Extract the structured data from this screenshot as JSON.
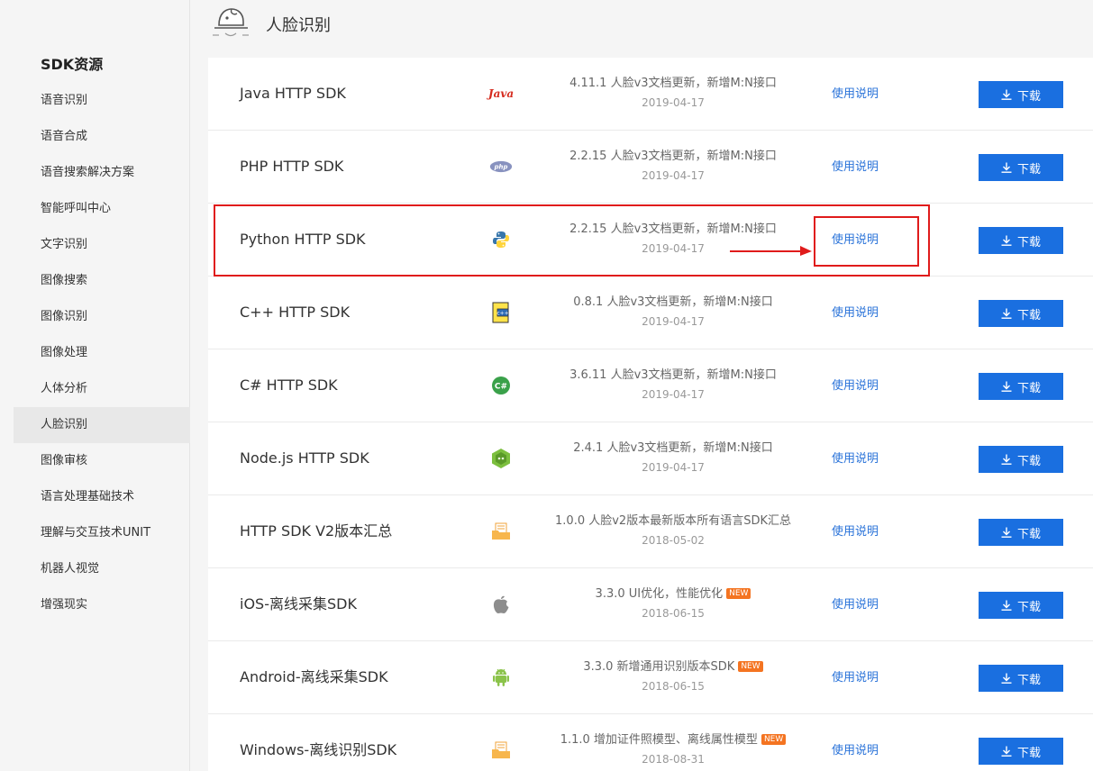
{
  "sidebar": {
    "title": "SDK资源",
    "items": [
      {
        "label": "语音识别"
      },
      {
        "label": "语音合成"
      },
      {
        "label": "语音搜索解决方案"
      },
      {
        "label": "智能呼叫中心"
      },
      {
        "label": "文字识别"
      },
      {
        "label": "图像搜索"
      },
      {
        "label": "图像识别"
      },
      {
        "label": "图像处理"
      },
      {
        "label": "人体分析"
      },
      {
        "label": "人脸识别",
        "active": true
      },
      {
        "label": "图像审核"
      },
      {
        "label": "语言处理基础技术"
      },
      {
        "label": "理解与交互技术UNIT"
      },
      {
        "label": "机器人视觉"
      },
      {
        "label": "增强现实"
      }
    ]
  },
  "header": {
    "title": "人脸识别",
    "icon": "face-recognition-icon"
  },
  "sdks": [
    {
      "name": "Java HTTP SDK",
      "logo": "java-logo",
      "logo_text": "Java",
      "version": "4.11.1 人脸v3文档更新，新增M:N接口",
      "date": "2019-04-17",
      "is_new": false
    },
    {
      "name": "PHP HTTP SDK",
      "logo": "php-logo",
      "logo_text": "php",
      "version": "2.2.15 人脸v3文档更新，新增M:N接口",
      "date": "2019-04-17",
      "is_new": false
    },
    {
      "name": "Python HTTP SDK",
      "logo": "python-logo",
      "version": "2.2.15 人脸v3文档更新，新增M:N接口",
      "date": "2019-04-17",
      "is_new": false
    },
    {
      "name": "C++ HTTP SDK",
      "logo": "cpp-logo",
      "version": "0.8.1 人脸v3文档更新，新增M:N接口",
      "date": "2019-04-17",
      "is_new": false
    },
    {
      "name": "C# HTTP SDK",
      "logo": "csharp-logo",
      "logo_text": "C#",
      "version": "3.6.11 人脸v3文档更新，新增M:N接口",
      "date": "2019-04-17",
      "is_new": false
    },
    {
      "name": "Node.js HTTP SDK",
      "logo": "nodejs-logo",
      "version": "2.4.1 人脸v3文档更新，新增M:N接口",
      "date": "2019-04-17",
      "is_new": false
    },
    {
      "name": "HTTP SDK V2版本汇总",
      "logo": "folder-logo",
      "version": "1.0.0 人脸v2版本最新版本所有语言SDK汇总",
      "date": "2018-05-02",
      "is_new": false
    },
    {
      "name": "iOS-离线采集SDK",
      "logo": "apple-logo",
      "version": "3.3.0 UI优化，性能优化",
      "date": "2018-06-15",
      "is_new": true
    },
    {
      "name": "Android-离线采集SDK",
      "logo": "android-logo",
      "version": "3.3.0 新增通用识别版本SDK",
      "date": "2018-06-15",
      "is_new": true
    },
    {
      "name": "Windows-离线识别SDK",
      "logo": "folder-logo",
      "version": "1.1.0 增加证件照模型、离线属性模型",
      "date": "2018-08-31",
      "is_new": true
    }
  ],
  "labels": {
    "usage": "使用说明",
    "download": "下载",
    "new_badge": "NEW"
  },
  "colors": {
    "accent": "#1a6fe0",
    "link": "#2a73d9",
    "new_badge": "#f47421",
    "annotation": "#e01b1b"
  },
  "annotation": {
    "highlighted_row": "Python HTTP SDK"
  }
}
